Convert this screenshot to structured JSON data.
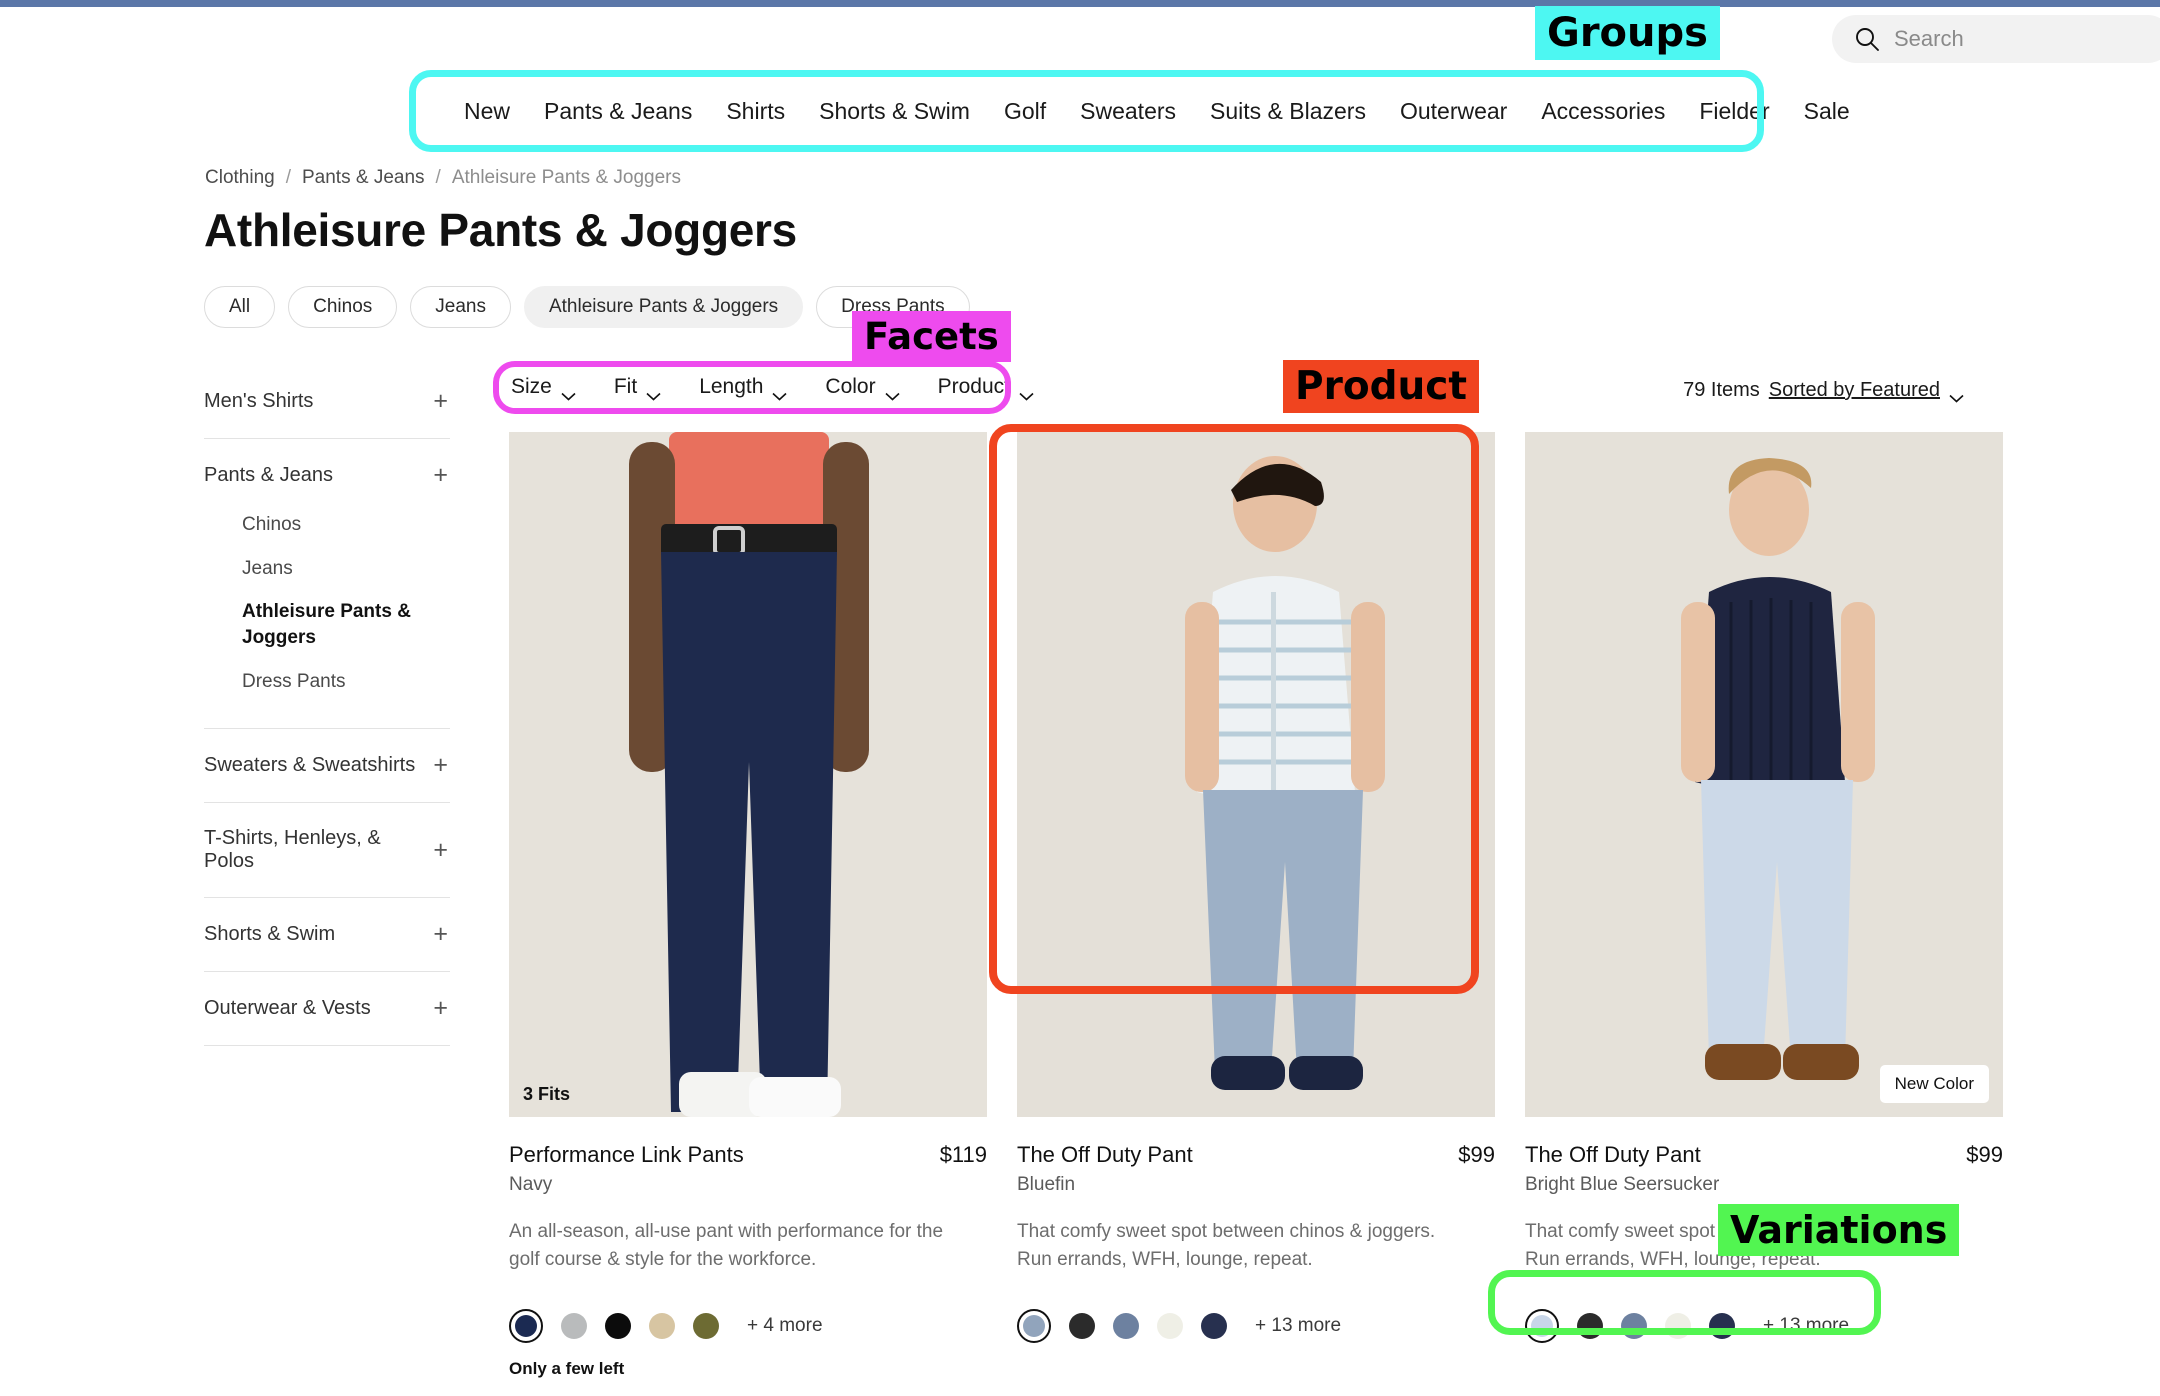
{
  "theme": {
    "top_strip_color": "#5b77a8",
    "selected_pill_bg": "#f0f0f0"
  },
  "search": {
    "placeholder": "Search",
    "icon": "search-icon"
  },
  "groups": {
    "items": [
      "New",
      "Pants & Jeans",
      "Shirts",
      "Shorts & Swim",
      "Golf",
      "Sweaters",
      "Suits & Blazers",
      "Outerwear",
      "Accessories",
      "Fielder",
      "Sale"
    ]
  },
  "breadcrumb": {
    "items": [
      "Clothing",
      "Pants & Jeans",
      "Athleisure Pants & Joggers"
    ],
    "separator": "/"
  },
  "page": {
    "title": "Athleisure Pants & Joggers"
  },
  "category_pills": {
    "items": [
      {
        "label": "All",
        "selected": false
      },
      {
        "label": "Chinos",
        "selected": false
      },
      {
        "label": "Jeans",
        "selected": false
      },
      {
        "label": "Athleisure Pants & Joggers",
        "selected": true
      },
      {
        "label": "Dress Pants",
        "selected": false
      }
    ]
  },
  "sidebar": {
    "groups": [
      {
        "label": "Men's Shirts",
        "expander": "+",
        "children": []
      },
      {
        "label": "Pants & Jeans",
        "expander": "+",
        "children": [
          {
            "label": "Chinos",
            "current": false
          },
          {
            "label": "Jeans",
            "current": false
          },
          {
            "label": "Athleisure Pants & Joggers",
            "current": true
          },
          {
            "label": "Dress Pants",
            "current": false
          }
        ]
      },
      {
        "label": "Sweaters & Sweatshirts",
        "expander": "+",
        "children": []
      },
      {
        "label": "T-Shirts, Henleys, & Polos",
        "expander": "+",
        "children": []
      },
      {
        "label": "Shorts & Swim",
        "expander": "+",
        "children": []
      },
      {
        "label": "Outerwear & Vests",
        "expander": "+",
        "children": []
      }
    ]
  },
  "facets": {
    "items": [
      "Size",
      "Fit",
      "Length",
      "Color",
      "Product"
    ],
    "chevron": "chevron-down-icon"
  },
  "results": {
    "count_label": "79 Items",
    "sort_label": "Sorted by Featured",
    "chevron": "chevron-down-icon"
  },
  "products": [
    {
      "title": "Performance Link Pants",
      "price": "$119",
      "color_name": "Navy",
      "description": "An all-season, all-use pant with performance for the golf course & style for the workforce.",
      "image_badge": "3 Fits",
      "corner_badge": "",
      "stock_note": "Only a few left",
      "swatches": [
        {
          "hex": "#1b2a52",
          "selected": true
        },
        {
          "hex": "#b9bbbc",
          "selected": false
        },
        {
          "hex": "#0c0c0c",
          "selected": false
        },
        {
          "hex": "#d7c5a2",
          "selected": false
        },
        {
          "hex": "#6d6b33",
          "selected": false
        }
      ],
      "more_label": "+ 4 more"
    },
    {
      "title": "The Off Duty Pant",
      "price": "$99",
      "color_name": "Bluefin",
      "description": "That comfy sweet spot between chinos & joggers. Run errands, WFH, lounge, repeat.",
      "image_badge": "",
      "corner_badge": "",
      "stock_note": "",
      "swatches": [
        {
          "hex": "#91a4bc",
          "selected": true
        },
        {
          "hex": "#2b2b2b",
          "selected": false
        },
        {
          "hex": "#6d81a0",
          "selected": false
        },
        {
          "hex": "#efefe6",
          "selected": false
        },
        {
          "hex": "#27304f",
          "selected": false
        }
      ],
      "more_label": "+ 13 more"
    },
    {
      "title": "The Off Duty Pant",
      "price": "$99",
      "color_name": "Bright Blue Seersucker",
      "description": "That comfy sweet spot between chinos & joggers. Run errands, WFH, lounge, repeat.",
      "image_badge": "",
      "corner_badge": "New Color",
      "stock_note": "",
      "swatches": [
        {
          "hex": "#c8d6e8",
          "selected": true
        },
        {
          "hex": "#2b2b2b",
          "selected": false
        },
        {
          "hex": "#6d81a0",
          "selected": false
        },
        {
          "hex": "#efefe6",
          "selected": false
        },
        {
          "hex": "#27304f",
          "selected": false
        }
      ],
      "more_label": "+ 13 more"
    }
  ],
  "annotations": [
    {
      "label": "Groups",
      "color": "#4DF7F2"
    },
    {
      "label": "Facets",
      "color": "#EE4BEE"
    },
    {
      "label": "Product",
      "color": "#F0441F"
    },
    {
      "label": "Variations",
      "color": "#52F551"
    }
  ]
}
